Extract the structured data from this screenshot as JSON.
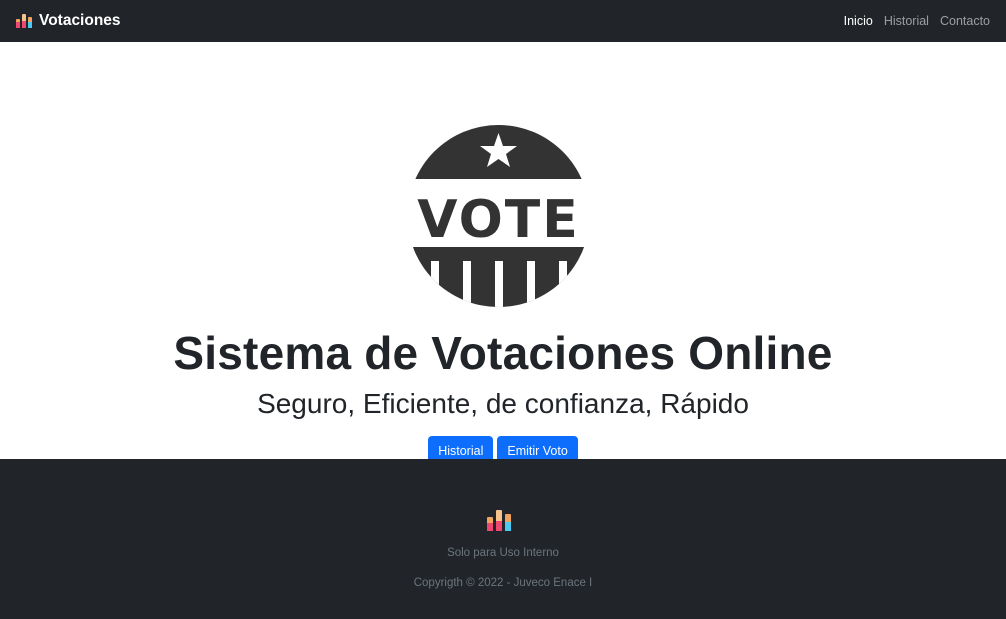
{
  "navbar": {
    "brand": "Votaciones",
    "links": [
      {
        "label": "Inicio",
        "active": true
      },
      {
        "label": "Historial",
        "active": false
      },
      {
        "label": "Contacto",
        "active": false
      }
    ]
  },
  "hero": {
    "logo_text": "VOTE",
    "title": "Sistema de Votaciones Online",
    "subtitle": "Seguro, Eficiente, de confianza, Rápido",
    "buttons": [
      "Historial",
      "Emitir Voto"
    ]
  },
  "footer": {
    "text": "Solo para Uso Interno",
    "copyright": "Copyrigth © 2022 - Juveco Enace I"
  },
  "colors": {
    "navbar_bg": "#212529",
    "primary": "#0d6efd",
    "muted": "#6c757d"
  }
}
